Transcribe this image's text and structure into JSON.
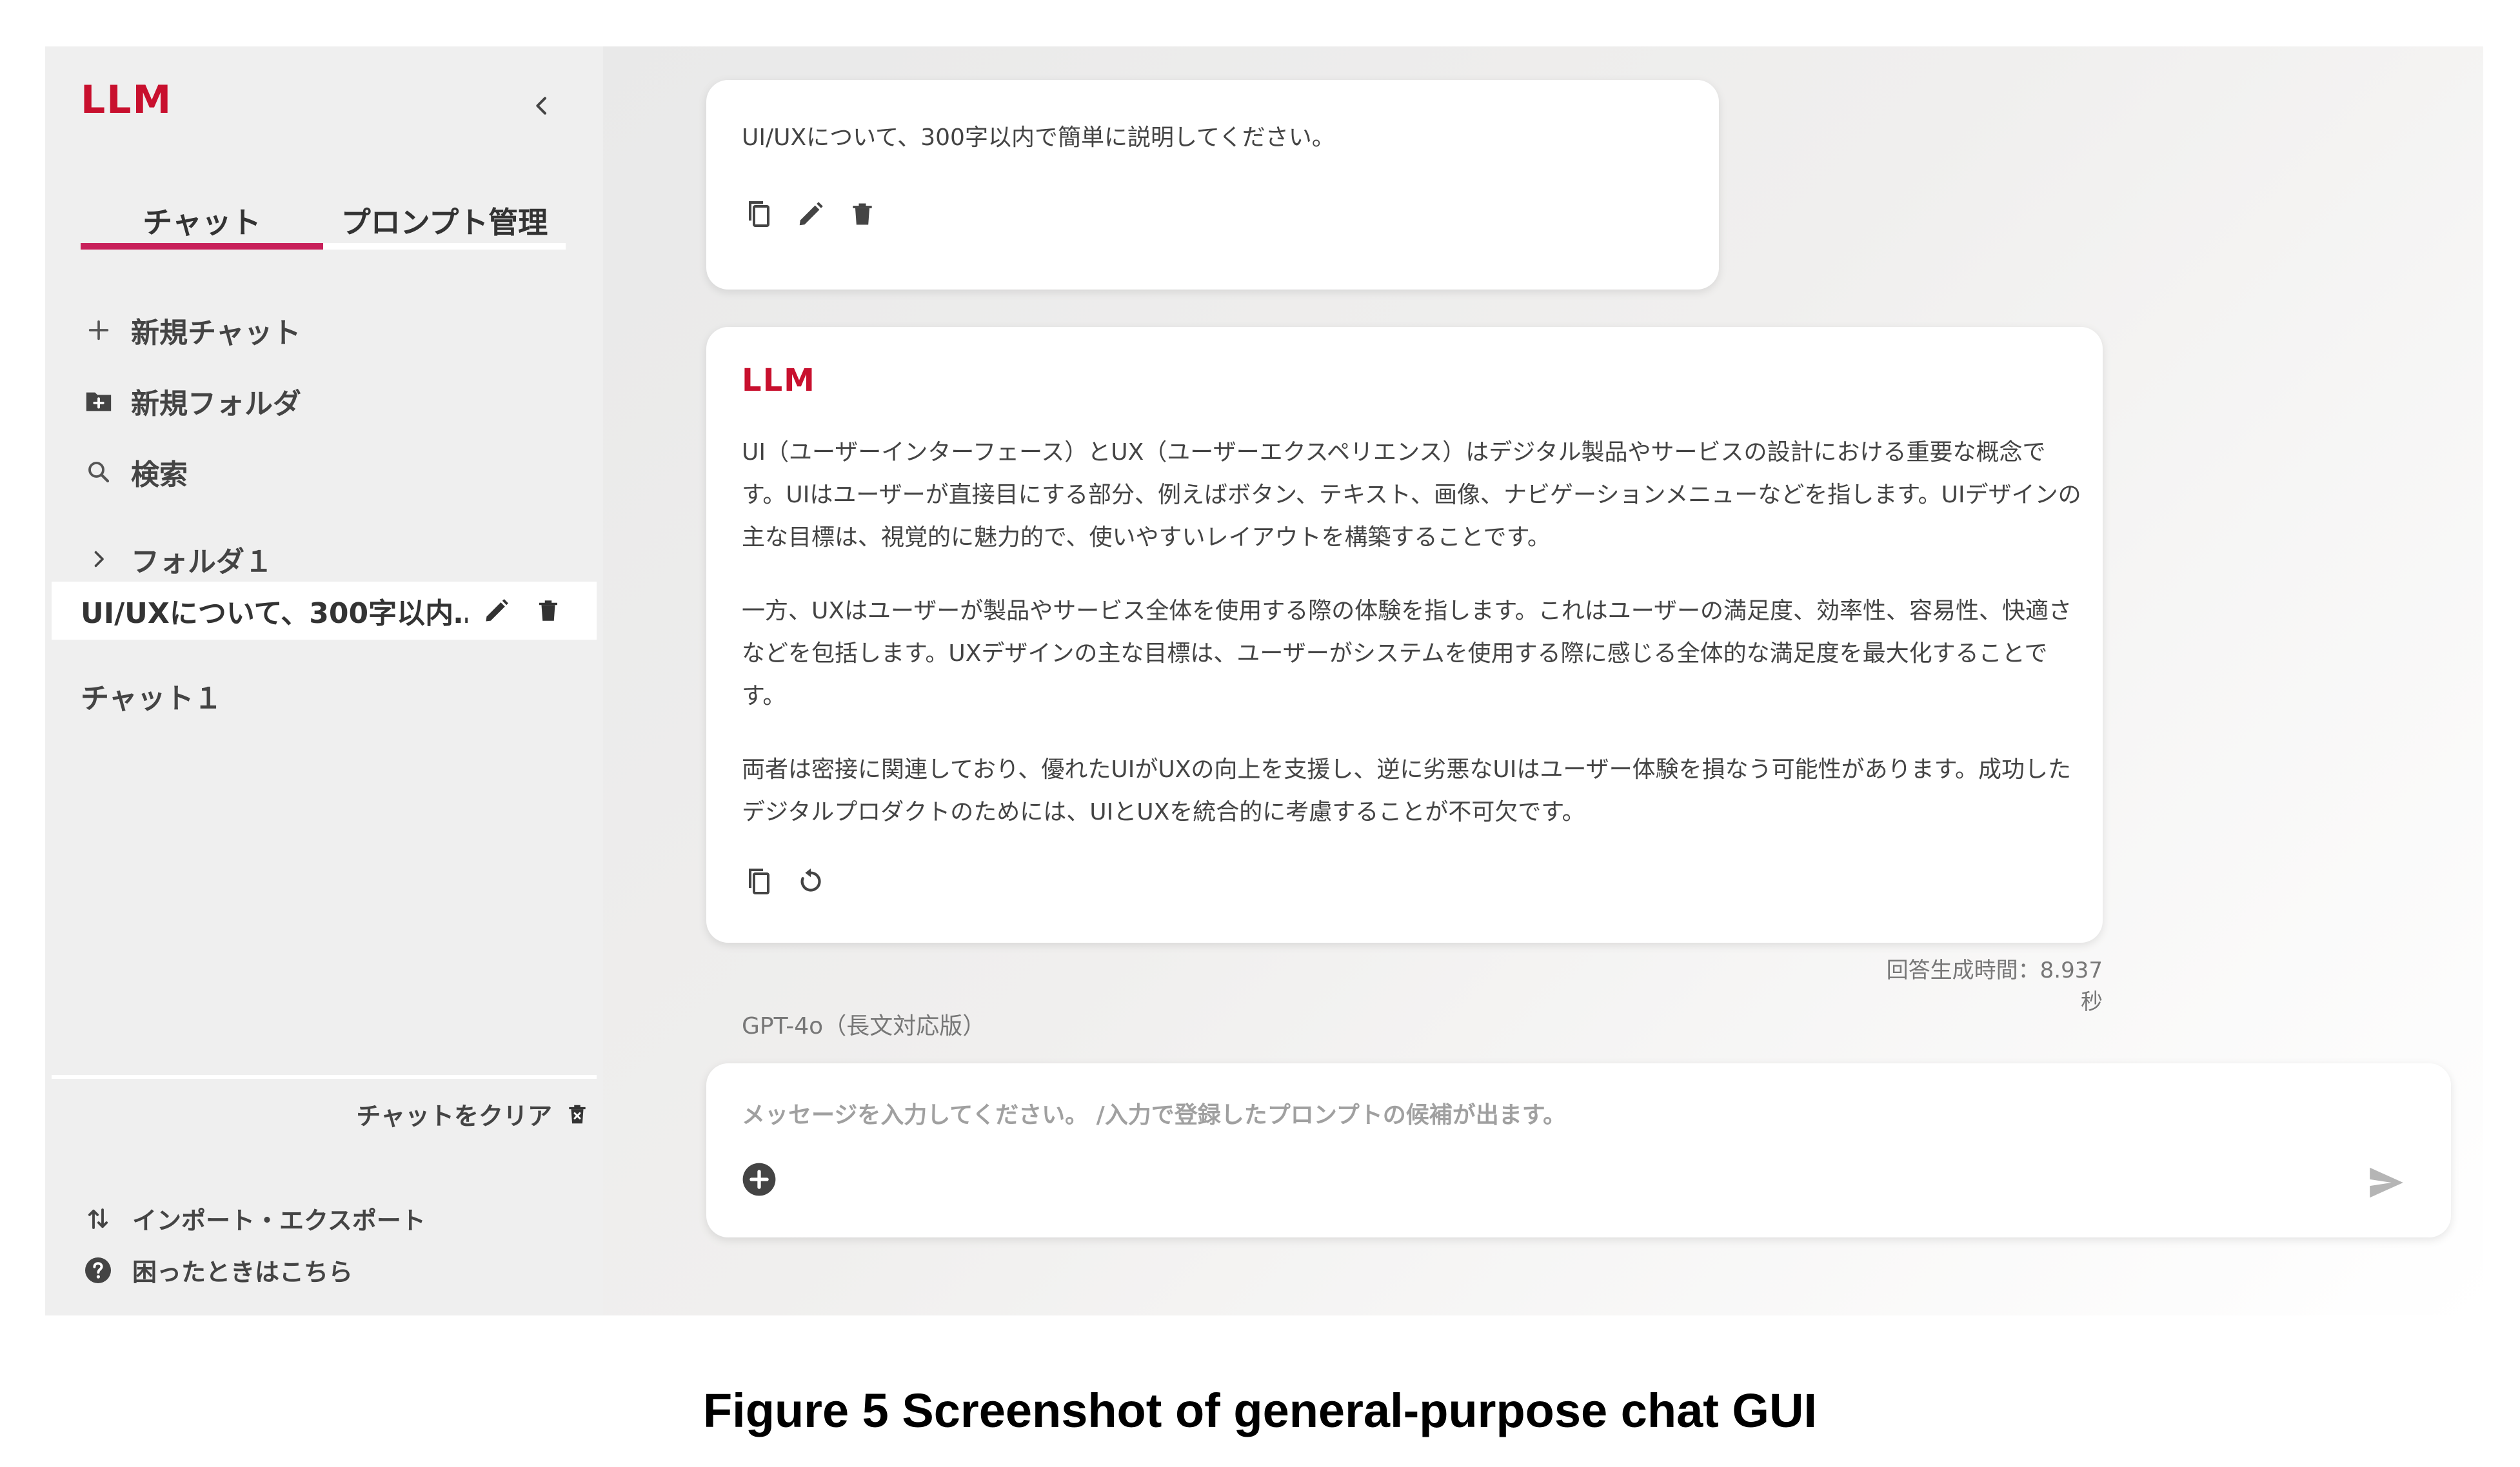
{
  "sidebar": {
    "logo": "LLM",
    "tabs": [
      {
        "label": "チャット",
        "active": true
      },
      {
        "label": "プロンプト管理",
        "active": false
      }
    ],
    "new_chat": "新規チャット",
    "new_folder": "新規フォルダ",
    "search": "検索",
    "folders": [
      {
        "label": "フォルダ１"
      }
    ],
    "active_chat": "UI/UXについて、300字以内…",
    "chats": [
      {
        "label": "チャット１"
      }
    ],
    "clear_chat": "チャットをクリア",
    "import_export": "インポート・エクスポート",
    "help": "困ったときはこちら"
  },
  "messages": {
    "user": {
      "text": "UI/UXについて、300字以内で簡単に説明してください。"
    },
    "assistant": {
      "logo": "LLM",
      "paragraphs": [
        "UI（ユーザーインターフェース）とUX（ユーザーエクスペリエンス）はデジタル製品やサービスの設計における重要な概念です。UIはユーザーが直接目にする部分、例えばボタン、テキスト、画像、ナビゲーションメニューなどを指します。UIデザインの主な目標は、視覚的に魅力的で、使いやすいレイアウトを構築することです。",
        "一方、UXはユーザーが製品やサービス全体を使用する際の体験を指します。これはユーザーの満足度、効率性、容易性、快適さなどを包括します。UXデザインの主な目標は、ユーザーがシステムを使用する際に感じる全体的な満足度を最大化することです。",
        "両者は密接に関連しており、優れたUIがUXの向上を支援し、逆に劣悪なUIはユーザー体験を損なう可能性があります。成功したデジタルプロダクトのためには、UIとUXを統合的に考慮することが不可欠です。"
      ],
      "generation_time": "回答生成時間：8.937秒"
    }
  },
  "model": "GPT-4o（長文対応版）",
  "input": {
    "placeholder": "メッセージを入力してください。 /入力で登録したプロンプトの候補が出ます。",
    "value": ""
  },
  "caption": "Figure 5  Screenshot of general-purpose chat GUI",
  "colors": {
    "brand": "#c8102e",
    "tab_active": "#c8205a",
    "sidebar_bg": "#efefef"
  },
  "icons": {
    "collapse": "chevron-left-icon",
    "new_chat": "plus-icon",
    "new_folder": "folder-plus-icon",
    "search": "search-icon",
    "folder": "chevron-right-icon",
    "edit": "pencil-icon",
    "delete": "trash-icon",
    "copy": "copy-icon",
    "regenerate": "refresh-icon",
    "clear": "trash-x-icon",
    "import_export": "swap-vertical-icon",
    "help": "help-circle-icon",
    "add": "plus-circle-icon",
    "send": "send-icon"
  }
}
